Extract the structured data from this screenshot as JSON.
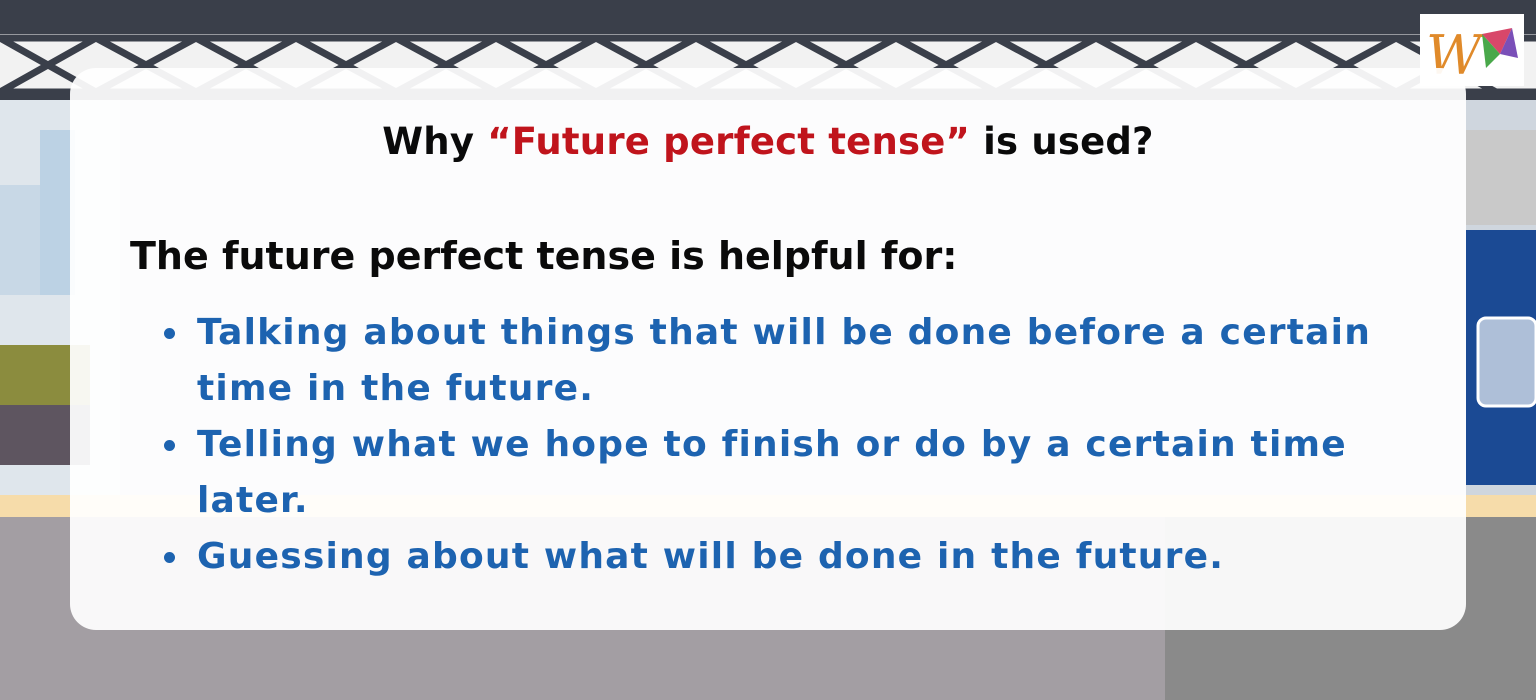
{
  "slide": {
    "heading_pre": "Why ",
    "heading_highlight": "“Future perfect tense”",
    "heading_post": " is used?",
    "intro": "The future perfect tense is helpful for:",
    "bullets": [
      "Talking about things that will be done before a certain time in the future.",
      "Telling what we hope to finish or do by a certain time later.",
      "Guessing about what will be done in the future."
    ]
  },
  "colors": {
    "heading": "#0a0a0a",
    "highlight": "#c0141c",
    "bullet_text": "#1d63b0",
    "card": "#ffffff"
  },
  "logo": {
    "icon": "w-logo-icon"
  }
}
